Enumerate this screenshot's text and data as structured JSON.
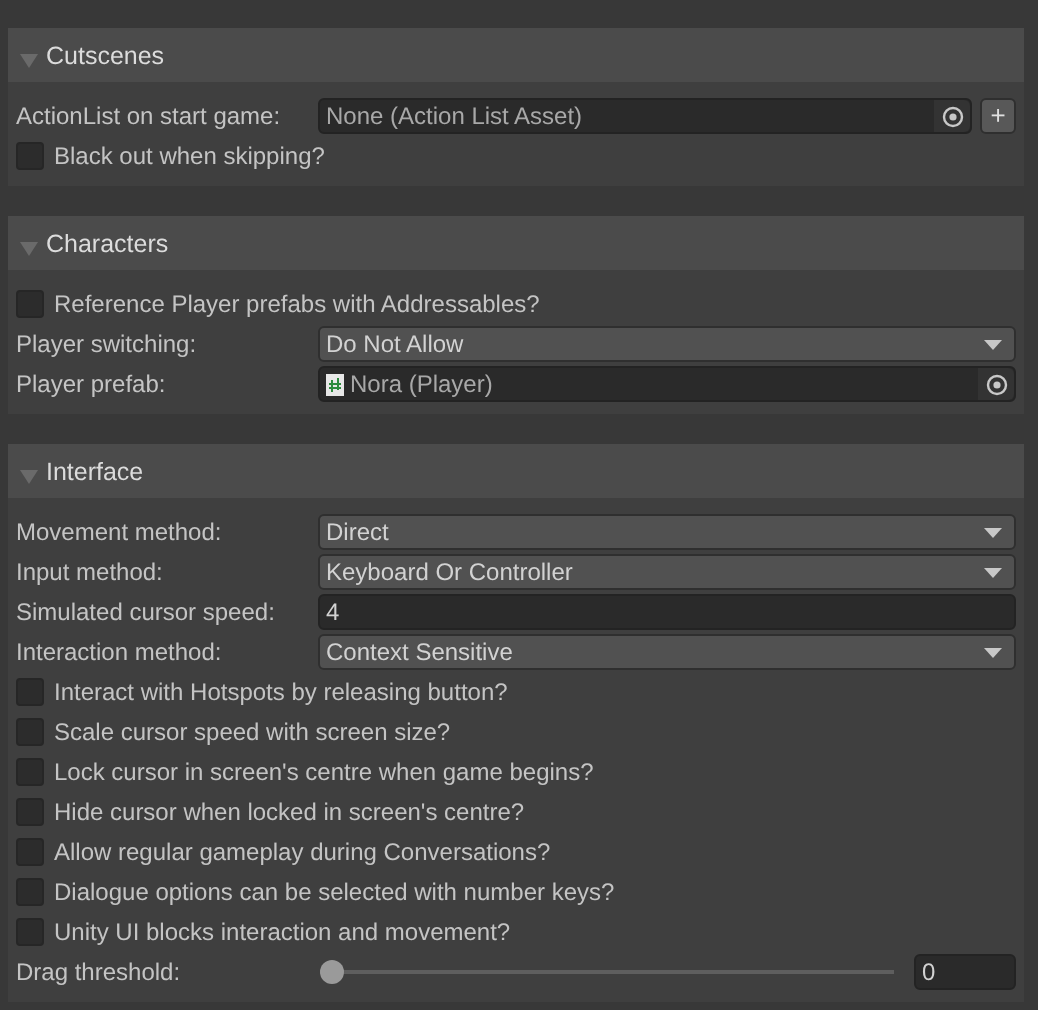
{
  "sections": [
    {
      "title": "Cutscenes",
      "expanded": true,
      "rows": [
        {
          "kind": "object",
          "label": "ActionList on start game:",
          "value": "None (Action List Asset)",
          "has_icon": false,
          "add_button": "+"
        },
        {
          "kind": "checkbox",
          "label": "Black out when skipping?",
          "checked": false
        }
      ]
    },
    {
      "title": "Characters",
      "expanded": true,
      "rows": [
        {
          "kind": "checkbox",
          "label": "Reference Player prefabs with Addressables?",
          "checked": false
        },
        {
          "kind": "dropdown",
          "label": "Player switching:",
          "value": "Do Not Allow"
        },
        {
          "kind": "object",
          "label": "Player prefab:",
          "value": "Nora (Player)",
          "has_icon": true
        }
      ]
    },
    {
      "title": "Interface",
      "expanded": true,
      "rows": [
        {
          "kind": "dropdown",
          "label": "Movement method:",
          "value": "Direct"
        },
        {
          "kind": "dropdown",
          "label": "Input method:",
          "value": "Keyboard Or Controller"
        },
        {
          "kind": "number",
          "label": "Simulated cursor speed:",
          "value": "4"
        },
        {
          "kind": "dropdown",
          "label": "Interaction method:",
          "value": "Context Sensitive"
        },
        {
          "kind": "checkbox",
          "label": "Interact with Hotspots by releasing button?",
          "checked": false
        },
        {
          "kind": "checkbox",
          "label": "Scale cursor speed with screen size?",
          "checked": false
        },
        {
          "kind": "checkbox",
          "label": "Lock cursor in screen's centre when game begins?",
          "checked": false
        },
        {
          "kind": "checkbox",
          "label": "Hide cursor when locked in screen's centre?",
          "checked": false
        },
        {
          "kind": "checkbox",
          "label": "Allow regular gameplay during Conversations?",
          "checked": false
        },
        {
          "kind": "checkbox",
          "label": "Dialogue options can be selected with number keys?",
          "checked": false
        },
        {
          "kind": "checkbox",
          "label": "Unity UI blocks interaction and movement?",
          "checked": false
        },
        {
          "kind": "slider",
          "label": "Drag threshold:",
          "level": 0,
          "value": "0"
        }
      ]
    }
  ]
}
